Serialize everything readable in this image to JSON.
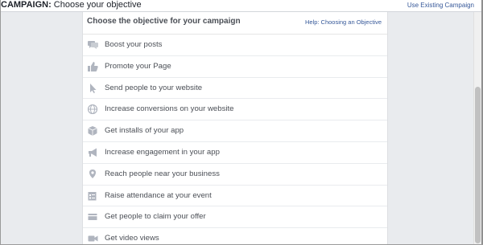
{
  "header": {
    "title_prefix": "CAMPAIGN:",
    "title_text": "Choose your objective",
    "use_existing_link": "Use Existing Campaign"
  },
  "panel": {
    "title": "Choose the objective for your campaign",
    "help_link": "Help: Choosing an Objective",
    "objectives": [
      {
        "label": "Boost your posts",
        "icon": "speech-bubbles-icon"
      },
      {
        "label": "Promote your Page",
        "icon": "thumbs-up-icon"
      },
      {
        "label": "Send people to your website",
        "icon": "cursor-pointer-icon"
      },
      {
        "label": "Increase conversions on your website",
        "icon": "globe-icon"
      },
      {
        "label": "Get installs of your app",
        "icon": "app-box-icon"
      },
      {
        "label": "Increase engagement in your app",
        "icon": "megaphone-icon"
      },
      {
        "label": "Reach people near your business",
        "icon": "map-pin-icon"
      },
      {
        "label": "Raise attendance at your event",
        "icon": "calendar-event-icon"
      },
      {
        "label": "Get people to claim your offer",
        "icon": "offer-tag-icon"
      },
      {
        "label": "Get video views",
        "icon": "video-camera-icon"
      }
    ]
  },
  "colors": {
    "background": "#e9ebee",
    "link": "#365899",
    "icon": "#b0b5bf",
    "text": "#4b4f56"
  }
}
